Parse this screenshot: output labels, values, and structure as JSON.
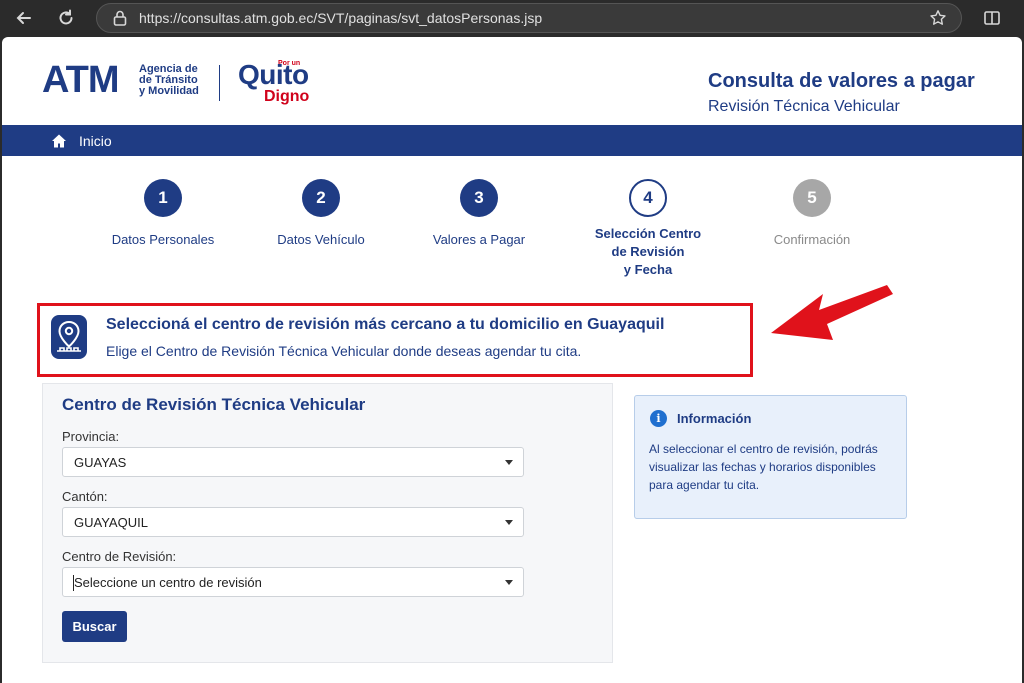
{
  "browser": {
    "url": "https://consultas.atm.gob.ec/SVT/paginas/svt_datosPersonas.jsp",
    "icons": [
      "back-icon",
      "reload-icon",
      "lock-icon",
      "star-icon",
      "sidebar-icon"
    ]
  },
  "header": {
    "atm": "ATM",
    "agency_line1": "Agencia de",
    "agency_line2": "de Tránsito",
    "agency_line3": "y Movilidad",
    "quito_small": "Por un",
    "quito": "Quito",
    "digno": "Digno",
    "title": "Consulta de valores a pagar",
    "subtitle": "Revisión Técnica Vehicular"
  },
  "nav": {
    "home": "Inicio"
  },
  "steps": [
    {
      "number": "1",
      "label": "Datos Personales",
      "state": "done"
    },
    {
      "number": "2",
      "label": "Datos Vehículo",
      "state": "done"
    },
    {
      "number": "3",
      "label": "Valores a Pagar",
      "state": "done"
    },
    {
      "number": "4",
      "label_lines": [
        "Selección Centro",
        "de Revisión",
        "y Fecha"
      ],
      "state": "current"
    },
    {
      "number": "5",
      "label": "Confirmación",
      "state": "pending"
    }
  ],
  "banner": {
    "title": "Seleccioná el centro de revisión más cercano a tu domicilio en Guayaquil",
    "description": "Elige el Centro de Revisión Técnica Vehicular donde deseas agendar tu cita."
  },
  "form": {
    "title": "Centro de Revisión Técnica Vehicular",
    "provincia_label": "Provincia:",
    "provincia_value": "GUAYAS",
    "canton_label": "Cantón:",
    "canton_value": "GUAYAQUIL",
    "centro_label": "Centro de Revisión:",
    "centro_placeholder": "Seleccione un centro de revisión",
    "submit": "Buscar"
  },
  "info": {
    "title": "Información",
    "text": "Al seleccionar el centro de revisión, podrás visualizar las fechas y horarios disponibles para agendar tu cita."
  },
  "colors": {
    "brand": "#1f3c84",
    "highlight": "#e0121b",
    "info_bg": "#e8f0fb"
  }
}
